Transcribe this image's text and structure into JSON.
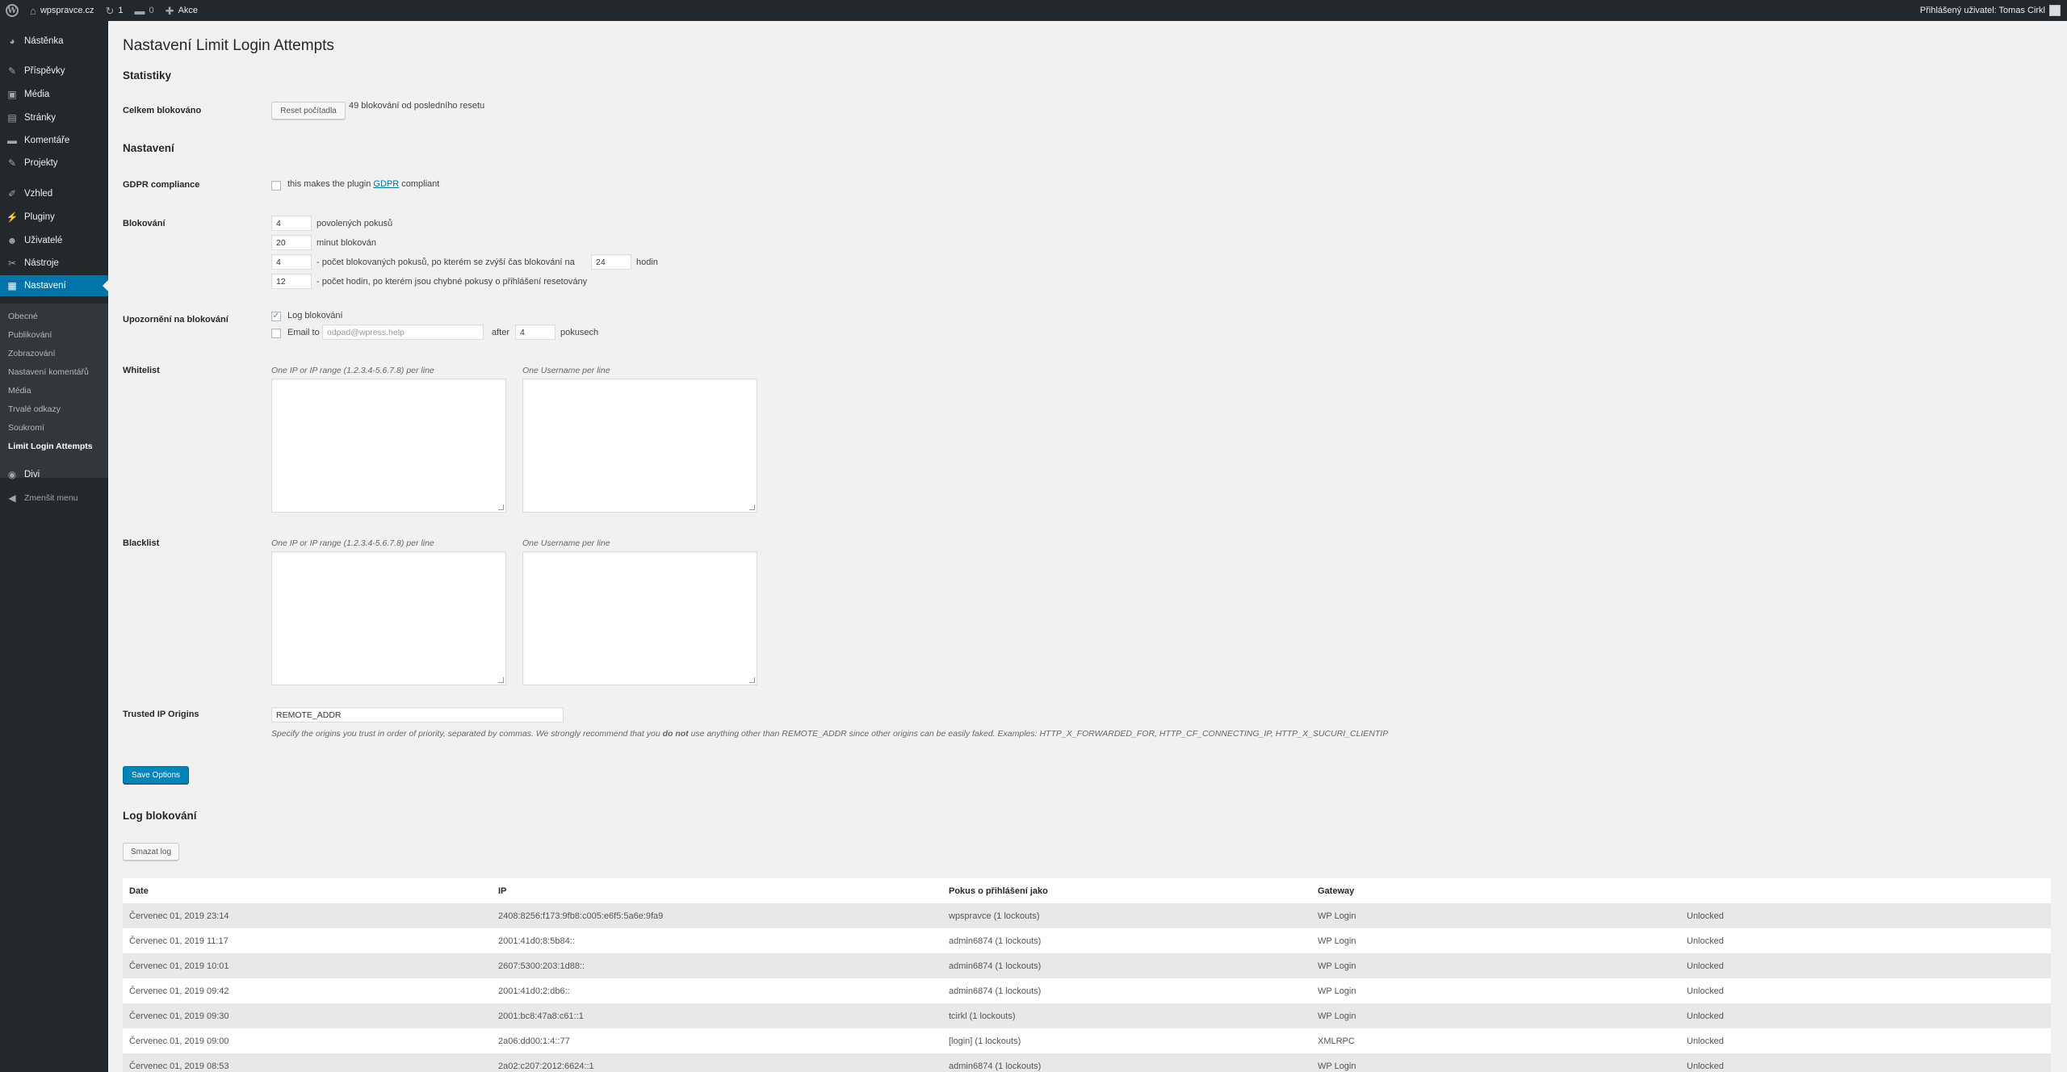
{
  "adminbar": {
    "site_name": "wpspravce.cz",
    "updates_count": "1",
    "comments_count": "0",
    "new_label": "Akce",
    "howdy": "Přihlášený uživatel: Tomas Cirkl"
  },
  "sidebar": {
    "items": [
      {
        "label": "Nástěnka",
        "icon": "dashboard-icon",
        "glyph": "◕"
      },
      {
        "label": "Příspěvky",
        "icon": "pin-icon",
        "glyph": "✎"
      },
      {
        "label": "Média",
        "icon": "media-icon",
        "glyph": "▣"
      },
      {
        "label": "Stránky",
        "icon": "pages-icon",
        "glyph": "▤"
      },
      {
        "label": "Komentáře",
        "icon": "comments-icon",
        "glyph": "▬"
      },
      {
        "label": "Projekty",
        "icon": "pin-icon",
        "glyph": "✎"
      },
      {
        "label": "Vzhled",
        "icon": "appearance-icon",
        "glyph": "✐"
      },
      {
        "label": "Pluginy",
        "icon": "plugins-icon",
        "glyph": "⚡"
      },
      {
        "label": "Uživatelé",
        "icon": "users-icon",
        "glyph": "☻"
      },
      {
        "label": "Nástroje",
        "icon": "tools-icon",
        "glyph": "✂"
      },
      {
        "label": "Nastavení",
        "icon": "settings-icon",
        "glyph": "▦"
      }
    ],
    "submenu": [
      "Obecné",
      "Publikování",
      "Zobrazování",
      "Nastavení komentářů",
      "Média",
      "Trvalé odkazy",
      "Soukromí",
      "Limit Login Attempts"
    ],
    "divi_label": "Divi",
    "collapse_label": "Zmenšit menu"
  },
  "page": {
    "title": "Nastavení Limit Login Attempts",
    "stats_heading": "Statistiky",
    "total_label": "Celkem blokováno",
    "reset_button": "Reset počítadla",
    "total_text": "49 blokování od posledního resetu",
    "settings_heading": "Nastavení",
    "gdpr_label": "GDPR compliance",
    "gdpr_text_before": "this makes the plugin",
    "gdpr_link": "GDPR",
    "gdpr_text_after": "compliant",
    "lockout_label": "Blokování",
    "allowed_retries": "4",
    "allowed_retries_text": "povolených pokusů",
    "lockout_minutes": "20",
    "lockout_minutes_text": "minut blokován",
    "lockouts_increase": "4",
    "lockouts_increase_text": "- počet blokovaných pokusů, po kterém se zvýší čas blokování na",
    "lockout_hours": "24",
    "lockout_hours_text": "hodin",
    "valid_duration": "12",
    "valid_duration_text": "- počet hodin, po kterém jsou chybné pokusy o přihlášení resetovány",
    "notify_label": "Upozornění na blokování",
    "notify_log_text": "Log blokování",
    "notify_email_text": "Email to",
    "notify_email_placeholder": "odpad@wpress.help",
    "notify_after_text": "after",
    "notify_after_value": "4",
    "notify_after_unit": "pokusech",
    "whitelist_label": "Whitelist",
    "blacklist_label": "Blacklist",
    "ip_hint": "One IP or IP range (1.2.3.4-5.6.7.8) per line",
    "user_hint": "One Username per line",
    "trusted_label": "Trusted IP Origins",
    "trusted_value": "REMOTE_ADDR",
    "trusted_hint_before": "Specify the origins you trust in order of priority, separated by commas. We strongly recommend that you",
    "trusted_hint_bold": "do not",
    "trusted_hint_after": "use anything other than REMOTE_ADDR since other origins can be easily faked. Examples: HTTP_X_FORWARDED_FOR, HTTP_CF_CONNECTING_IP, HTTP_X_SUCURI_CLIENTIP",
    "save_button": "Save Options",
    "log_heading": "Log blokování",
    "clear_log_button": "Smazat log"
  },
  "log_table": {
    "headers": [
      "Date",
      "IP",
      "Pokus o přihlášení jako",
      "Gateway",
      ""
    ],
    "rows": [
      [
        "Červenec 01, 2019 23:14",
        "2408:8256:f173:9fb8:c005:e6f5:5a6e:9fa9",
        "wpspravce (1 lockouts)",
        "WP Login",
        "Unlocked"
      ],
      [
        "Červenec 01, 2019 11:17",
        "2001:41d0:8:5b84::",
        "admin6874 (1 lockouts)",
        "WP Login",
        "Unlocked"
      ],
      [
        "Červenec 01, 2019 10:01",
        "2607:5300:203:1d88::",
        "admin6874 (1 lockouts)",
        "WP Login",
        "Unlocked"
      ],
      [
        "Červenec 01, 2019 09:42",
        "2001:41d0:2:db6::",
        "admin6874 (1 lockouts)",
        "WP Login",
        "Unlocked"
      ],
      [
        "Červenec 01, 2019 09:30",
        "2001:bc8:47a8:c61::1",
        "tcirkl (1 lockouts)",
        "WP Login",
        "Unlocked"
      ],
      [
        "Červenec 01, 2019 09:00",
        "2a06:dd00:1:4::77",
        "[login] (1 lockouts)",
        "XMLRPC",
        "Unlocked"
      ],
      [
        "Červenec 01, 2019 08:53",
        "2a02:c207:2012:6624::1",
        "admin6874 (1 lockouts)",
        "WP Login",
        "Unlocked"
      ]
    ]
  },
  "colors": {
    "accent": "#0073aa",
    "adminbar": "#23282d",
    "background": "#f1f1f1"
  }
}
